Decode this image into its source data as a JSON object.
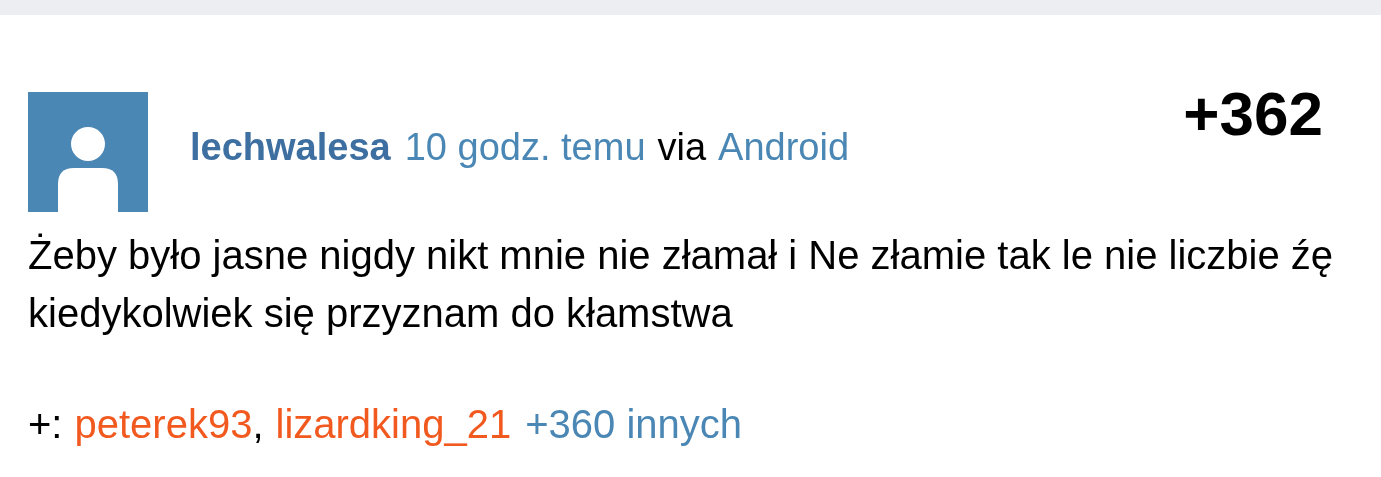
{
  "comment": {
    "author": "lechwalesa",
    "time": "10 godz. temu",
    "via_label": "via",
    "platform": "Android",
    "score": "+362",
    "body": "Żeby było jasne nigdy nikt mnie nie złamał i Ne złamie tak le nie liczbie źę kiedykolwiek się przyznam do kłamstwa",
    "plus_label": "+:",
    "voters": [
      "peterek93",
      "lizardking_21"
    ],
    "separator": ",",
    "others": "+360 innych"
  }
}
